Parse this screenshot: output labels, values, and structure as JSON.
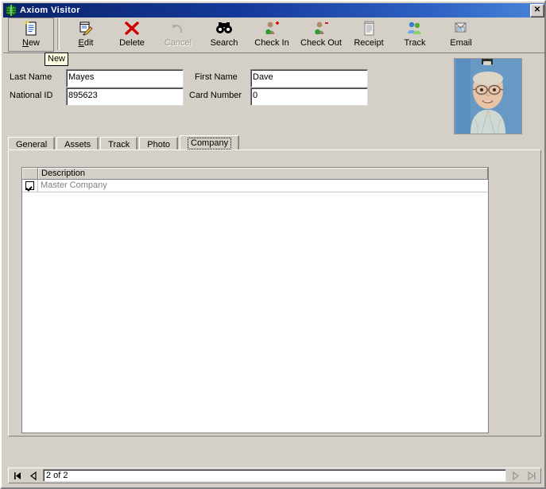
{
  "window": {
    "title": "Axiom  Visitor",
    "icon": "axiom-logo-icon",
    "close_label": "✕"
  },
  "toolbar": {
    "buttons": [
      {
        "label": "New",
        "icon": "new-document-icon",
        "disabled": false,
        "accel": "N"
      },
      {
        "label": "Edit",
        "icon": "edit-pencil-icon",
        "disabled": false,
        "accel": "E"
      },
      {
        "label": "Delete",
        "icon": "delete-x-icon",
        "disabled": false,
        "accel": ""
      },
      {
        "label": "Cancel",
        "icon": "undo-arrow-icon",
        "disabled": true,
        "accel": ""
      },
      {
        "label": "Search",
        "icon": "binoculars-icon",
        "disabled": false,
        "accel": ""
      },
      {
        "label": "Check In",
        "icon": "user-plus-icon",
        "disabled": false,
        "accel": ""
      },
      {
        "label": "Check Out",
        "icon": "user-minus-icon",
        "disabled": false,
        "accel": ""
      },
      {
        "label": "Receipt",
        "icon": "receipt-icon",
        "disabled": false,
        "accel": ""
      },
      {
        "label": "Track",
        "icon": "two-users-icon",
        "disabled": false,
        "accel": ""
      },
      {
        "label": "Email",
        "icon": "email-icon",
        "disabled": false,
        "accel": ""
      }
    ]
  },
  "tooltip": {
    "text": "New"
  },
  "form": {
    "last_name": {
      "label": "Last Name",
      "value": "Mayes"
    },
    "first_name": {
      "label": "First Name",
      "value": "Dave"
    },
    "national_id": {
      "label": "National ID",
      "value": "895623"
    },
    "card_number": {
      "label": "Card Number",
      "value": "0"
    }
  },
  "photo": {
    "alt": "visitor-photo"
  },
  "tabs": {
    "items": [
      {
        "label": "General",
        "selected": false
      },
      {
        "label": "Assets",
        "selected": false
      },
      {
        "label": "Track",
        "selected": false
      },
      {
        "label": "Photo",
        "selected": false
      },
      {
        "label": "Company",
        "selected": true
      }
    ]
  },
  "grid": {
    "columns": [
      "",
      "Description"
    ],
    "rows": [
      {
        "checked": true,
        "description": "Master Company"
      }
    ]
  },
  "navigator": {
    "first_label": "◀|",
    "prev_label": "◀",
    "position_text": "2 of 2",
    "next_label": "▶",
    "last_label": "|▶"
  },
  "colors": {
    "face": "#d4d0c8",
    "title_start": "#0a246a",
    "title_end": "#4a86d8",
    "tooltip_bg": "#ffffe1",
    "grid_text": "#808080"
  }
}
